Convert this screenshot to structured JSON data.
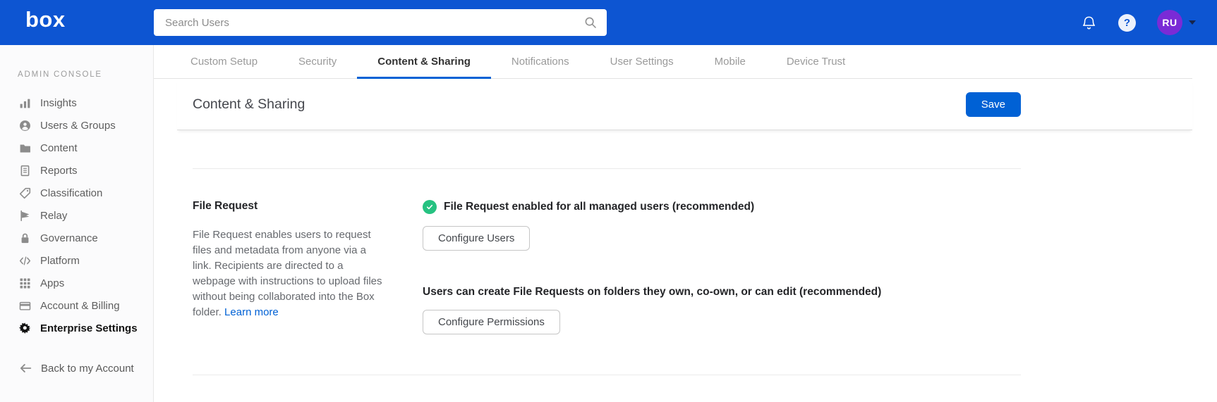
{
  "colors": {
    "header_blue": "#0d55d2",
    "accent_blue": "#0061d5",
    "success_green": "#26c281",
    "avatar_purple": "#7a2bd6"
  },
  "topbar": {
    "logo_text": "box",
    "search_placeholder": "Search Users",
    "help_glyph": "?",
    "avatar_initials": "RU"
  },
  "sidebar": {
    "section_label": "ADMIN CONSOLE",
    "items": [
      {
        "label": "Insights",
        "icon": "bar-chart-icon",
        "active": false
      },
      {
        "label": "Users & Groups",
        "icon": "users-icon",
        "active": false
      },
      {
        "label": "Content",
        "icon": "folder-icon",
        "active": false
      },
      {
        "label": "Reports",
        "icon": "report-icon",
        "active": false
      },
      {
        "label": "Classification",
        "icon": "tag-icon",
        "active": false
      },
      {
        "label": "Relay",
        "icon": "flag-icon",
        "active": false
      },
      {
        "label": "Governance",
        "icon": "lock-icon",
        "active": false
      },
      {
        "label": "Platform",
        "icon": "code-icon",
        "active": false
      },
      {
        "label": "Apps",
        "icon": "grid-icon",
        "active": false
      },
      {
        "label": "Account & Billing",
        "icon": "credit-card-icon",
        "active": false
      },
      {
        "label": "Enterprise Settings",
        "icon": "gear-icon",
        "active": true
      }
    ],
    "back_label": "Back to my Account",
    "back_icon": "arrow-left-icon"
  },
  "tabs": [
    {
      "label": "Custom Setup",
      "active": false
    },
    {
      "label": "Security",
      "active": false
    },
    {
      "label": "Content & Sharing",
      "active": true
    },
    {
      "label": "Notifications",
      "active": false
    },
    {
      "label": "User Settings",
      "active": false
    },
    {
      "label": "Mobile",
      "active": false
    },
    {
      "label": "Device Trust",
      "active": false
    }
  ],
  "page": {
    "title": "Content & Sharing",
    "save_label": "Save"
  },
  "file_request": {
    "title": "File Request",
    "description": "File Request enables users to request files and metadata from anyone via a link. Recipients are directed to a webpage with instructions to upload files without being collaborated into the Box folder.",
    "learn_more_label": "Learn more",
    "status_icon": "check-circle-icon",
    "status_label": "File Request enabled for all managed users (recommended)",
    "configure_users_label": "Configure Users",
    "permissions_label": "Users can create File Requests on folders they own, co-own, or can edit (recommended)",
    "configure_permissions_label": "Configure Permissions"
  }
}
